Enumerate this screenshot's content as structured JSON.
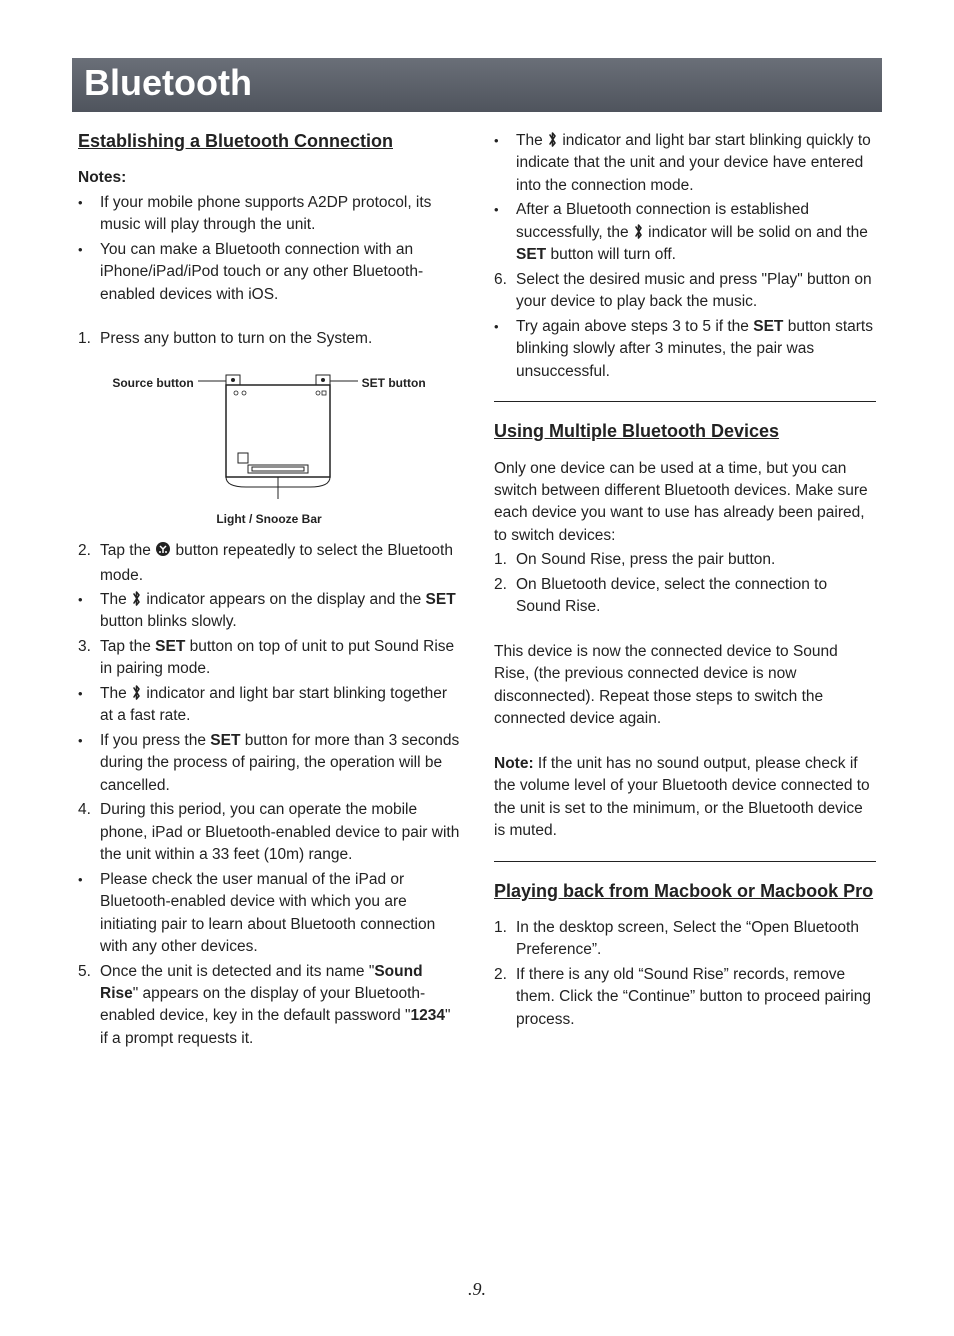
{
  "title": "Bluetooth",
  "page_number": ".9.",
  "left": {
    "h_establish": "Establishing a Bluetooth Connection",
    "notes_label": "Notes:",
    "notes": [
      "If your mobile phone supports A2DP protocol, its music will play through the unit.",
      "You can make a Bluetooth connection with an iPhone/iPad/iPod touch or any other Bluetooth-enabled devices with iOS."
    ],
    "step1": "Press any button to turn on the System.",
    "diagram": {
      "source_label": "Source button",
      "set_label": "SET button",
      "caption": "Light / Snooze Bar"
    },
    "step2_a": "Tap the ",
    "step2_b": " button repeatedly to select the Bluetooth mode.",
    "step2_sub1_a": "The ",
    "step2_sub1_b": " indicator appears on the display and the ",
    "step2_sub1_c": " button blinks slowly.",
    "step3_a": "Tap the ",
    "step3_b": " button on top of unit to put Sound Rise in pairing mode.",
    "step3_sub1_a": "The ",
    "step3_sub1_b": " indicator and light bar start blinking together at a fast rate.",
    "step3_sub2_a": " If  you  press  the ",
    "step3_sub2_b": " button for  more  than 3 seconds  during  the  process  of  pairing, the operation will be cancelled.",
    "step4": "During this period, you can operate the mobile phone, iPad or Bluetooth-enabled device to pair with the unit within a 33 feet (10m) range.",
    "step4_sub1": "Please check the user manual of the iPad or Bluetooth-enabled device with which you are initiating pair to learn about Bluetooth connection with any other devices.",
    "step5_a": "Once  the  unit  is  detected  and  its  name \"",
    "step5_b": "\" appears on the display of your Bluetooth-enabled device, key in the default password \"",
    "step5_c": "\" if a prompt requests it.",
    "sound_rise": "Sound Rise",
    "pwd": "1234",
    "set_word": "SET"
  },
  "right": {
    "top_b1_a": "The ",
    "top_b1_b": " indicator and light bar start blinking quickly to indicate that the unit and your device have entered  into  the connection mode.",
    "top_b2_a": "After a Bluetooth connection is established successfully, the ",
    "top_b2_b": " indicator will be solid on and the ",
    "top_b2_c": " button will turn off.",
    "step6": "Select the desired music and press \"Play\" button on your device to play back the music.",
    "step6_sub_a": "Try again above steps 3 to 5 if the ",
    "step6_sub_b": " button starts blinking slowly after 3 minutes, the pair was unsuccessful.",
    "h_multi": "Using Multiple Bluetooth Devices",
    "multi_intro": "Only one device can be used at a time, but you can switch between different Bluetooth devices.  Make  sure  each  device  you  want  to use  has already been paired, to switch devices:",
    "multi_step1": "On Sound Rise, press the pair button.",
    "multi_step2": "On Bluetooth device, select the connection to Sound Rise.",
    "multi_para2": "This device is now the connected device to Sound Rise,  (the  previous  connected  device is  now  disconnected). Repeat those steps to switch the connected device again.",
    "note_label": "Note: ",
    "note_body": "If  the  unit  has  no  sound  output, please check  if  the  volume  level  of  your Bluetooth device connected to the unit is set to the minimum, or the Bluetooth device is muted.",
    "h_macbook": "Playing back from Macbook or Macbook Pro",
    "mac_step1": "In   the   desktop   screen,    Select   the “Open Bluetooth Preference”.",
    "mac_step2": "If there is any old “Sound Rise” records, remove them.  Click the “Continue” button to proceed pairing process.",
    "set_word": "SET"
  }
}
